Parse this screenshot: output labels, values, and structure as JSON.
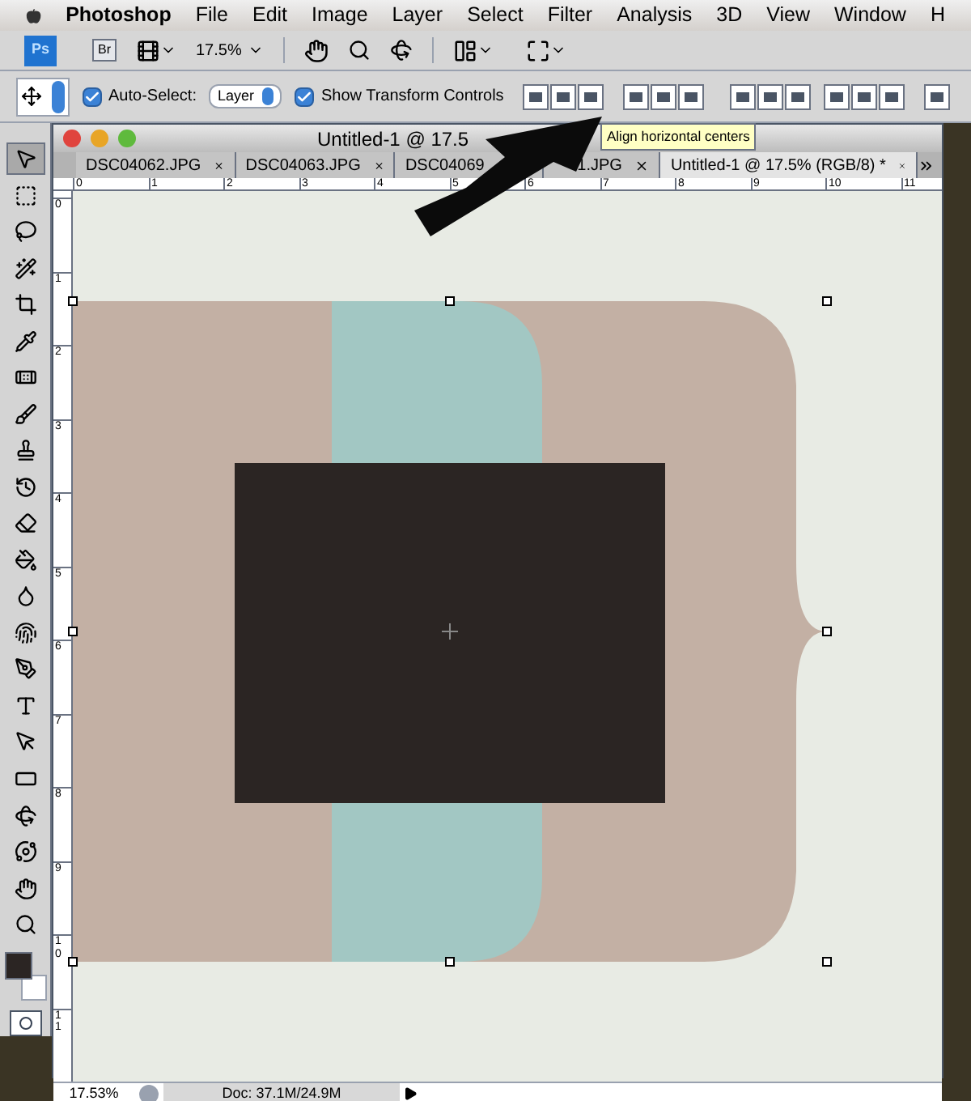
{
  "menu_bar": {
    "app_name": "Photoshop",
    "items": [
      "File",
      "Edit",
      "Image",
      "Layer",
      "Select",
      "Filter",
      "Analysis",
      "3D",
      "View",
      "Window",
      "H"
    ]
  },
  "app_bar": {
    "ps_label": "Ps",
    "br_label": "Br",
    "zoom": "17.5%"
  },
  "options_bar": {
    "auto_select": {
      "label": "Auto-Select:",
      "checked": true
    },
    "layer_dropdown": "Layer",
    "show_transform": {
      "label": "Show Transform Controls",
      "checked": true
    },
    "tooltip": "Align horizontal centers"
  },
  "tools": [
    {
      "kind": "move",
      "selected": true
    },
    {
      "kind": "marquee",
      "selected": false
    },
    {
      "kind": "lasso",
      "selected": false
    },
    {
      "kind": "wand",
      "selected": false
    },
    {
      "kind": "crop",
      "selected": false
    },
    {
      "kind": "eyedropper",
      "selected": false
    },
    {
      "kind": "heal",
      "selected": false
    },
    {
      "kind": "brush",
      "selected": false
    },
    {
      "kind": "stamp",
      "selected": false
    },
    {
      "kind": "history",
      "selected": false
    },
    {
      "kind": "eraser",
      "selected": false
    },
    {
      "kind": "bucket",
      "selected": false
    },
    {
      "kind": "blur",
      "selected": false
    },
    {
      "kind": "smudge",
      "selected": false
    },
    {
      "kind": "pen",
      "selected": false
    },
    {
      "kind": "type",
      "selected": false
    },
    {
      "kind": "select",
      "selected": false
    },
    {
      "kind": "shape",
      "selected": false
    },
    {
      "kind": "rotate",
      "selected": false
    },
    {
      "kind": "orbit",
      "selected": false
    },
    {
      "kind": "hand",
      "selected": false
    },
    {
      "kind": "zoom",
      "selected": false
    }
  ],
  "document": {
    "title": "Untitled-1 @ 17.5",
    "tabs": [
      {
        "label": "DSC04062.JPG",
        "selected": false
      },
      {
        "label": "DSC04063.JPG",
        "selected": false
      },
      {
        "label": "DSC04069",
        "selected": false
      },
      {
        "label": "1.JPG",
        "selected": false
      },
      {
        "label": "Untitled-1 @ 17.5% (RGB/8) *",
        "selected": true
      }
    ],
    "top_ruler": [
      "0",
      "1",
      "2",
      "3",
      "4",
      "5",
      "6",
      "7",
      "8",
      "9",
      "10",
      "11"
    ],
    "left_ruler": [
      "0",
      "1",
      "2",
      "3",
      "4",
      "5",
      "6",
      "7",
      "8",
      "9",
      "10",
      "11"
    ]
  },
  "status_bar": {
    "zoom": "17.53%",
    "doc_size": "Doc: 37.1M/24.9M"
  }
}
